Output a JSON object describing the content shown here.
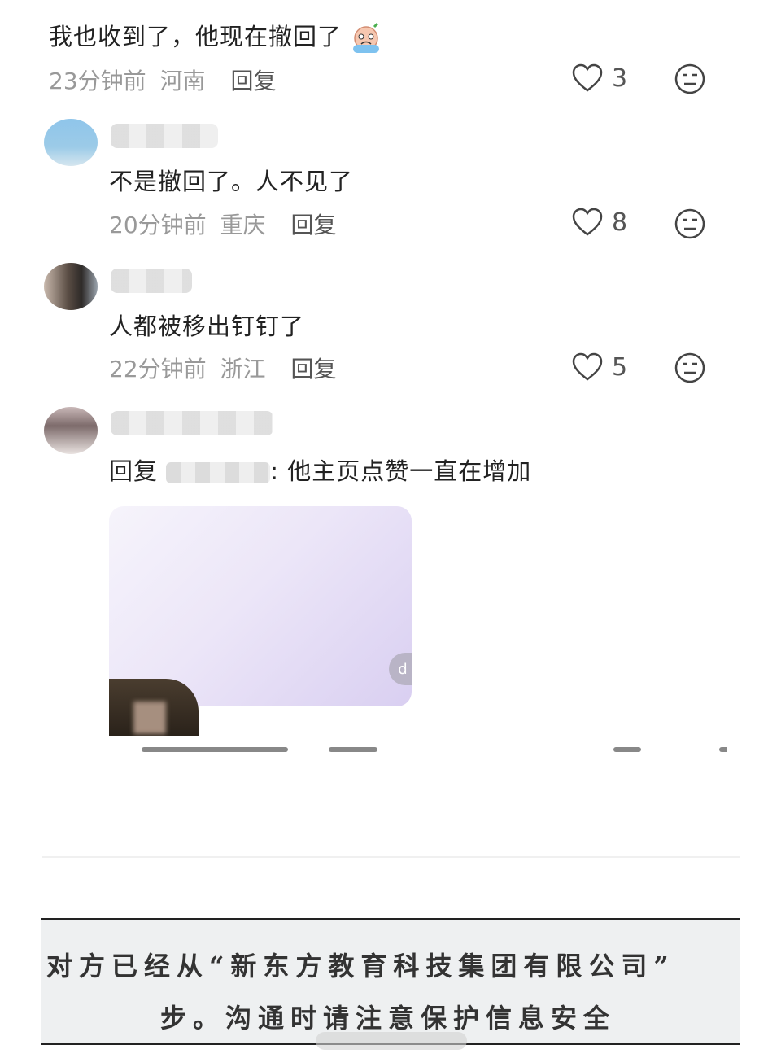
{
  "comments": [
    {
      "text": "我也收到了，他现在撤回了",
      "emoji": "crying-face-emoji",
      "time": "23分钟前",
      "location": "河南",
      "reply_label": "回复",
      "likes": "3"
    },
    {
      "text": "不是撤回了。人不见了",
      "time": "20分钟前",
      "location": "重庆",
      "reply_label": "回复",
      "likes": "8"
    },
    {
      "text": "人都被移出钉钉了",
      "time": "22分钟前",
      "location": "浙江",
      "reply_label": "回复",
      "likes": "5"
    },
    {
      "reply_prefix": "回复",
      "text_suffix": ": 他主页点赞一直在增加",
      "attachment_button": "d"
    }
  ],
  "notice": {
    "line1": "对方已经从“新东方教育科技集团有限公司”",
    "line2": "步。沟通时请注意保护信息安全"
  },
  "icons": {
    "like": "heart-outline-icon",
    "dislike": "meh-face-icon"
  },
  "colors": {
    "text": "#222222",
    "meta": "#999999",
    "notice_bg": "#eef0f1"
  }
}
